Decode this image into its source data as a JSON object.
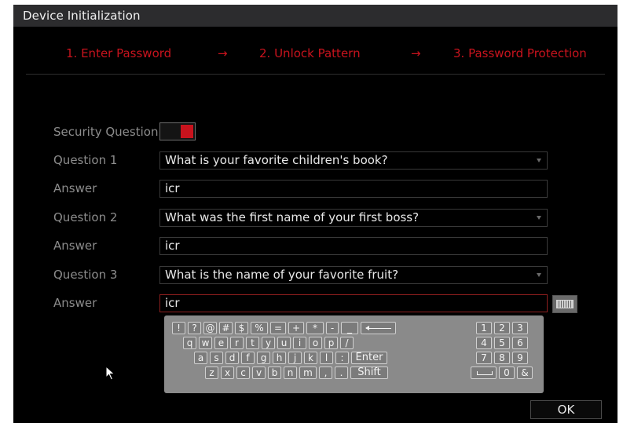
{
  "window": {
    "title": "Device Initialization"
  },
  "steps": [
    {
      "label": "1.  Enter Password"
    },
    {
      "label": "2.  Unlock Pattern"
    },
    {
      "label": "3.  Password Protection"
    }
  ],
  "step_arrow": "→",
  "form": {
    "security_question_label": "Security Question",
    "security_question_enabled": true,
    "rows": [
      {
        "question_label": "Question 1",
        "question_value": "What is your favorite children's book?",
        "answer_label": "Answer",
        "answer_value": "icr"
      },
      {
        "question_label": "Question 2",
        "question_value": "What was the first name of your first boss?",
        "answer_label": "Answer",
        "answer_value": "icr"
      },
      {
        "question_label": "Question 3",
        "question_value": "What is the name of your favorite fruit?",
        "answer_label": "Answer",
        "answer_value": "icr"
      }
    ]
  },
  "keyboard": {
    "row1": [
      "!",
      "?",
      "@",
      "#",
      "$",
      "%",
      "=",
      "+",
      "*",
      "-",
      "_"
    ],
    "row2": [
      "q",
      "w",
      "e",
      "r",
      "t",
      "y",
      "u",
      "i",
      "o",
      "p",
      "/"
    ],
    "row3": [
      "a",
      "s",
      "d",
      "f",
      "g",
      "h",
      "j",
      "k",
      "l",
      ":"
    ],
    "enter": "Enter",
    "row4": [
      "z",
      "x",
      "c",
      "v",
      "b",
      "n",
      "m",
      ",",
      "."
    ],
    "shift": "Shift",
    "numpad": [
      "1",
      "2",
      "3",
      "4",
      "5",
      "6",
      "7",
      "8",
      "9",
      "0",
      "&"
    ]
  },
  "ok_label": "OK",
  "colors": {
    "accent": "#c8131d",
    "label": "#8c8c8c",
    "keyboard_bg": "#8a8a8a"
  }
}
